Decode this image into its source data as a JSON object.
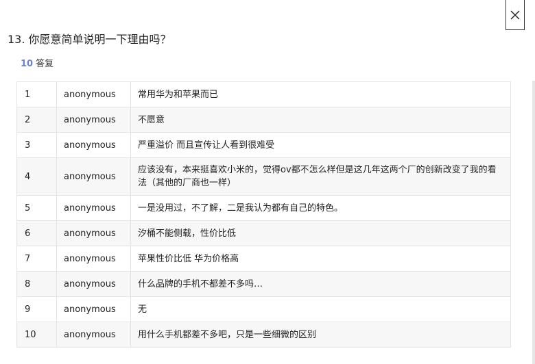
{
  "header": {
    "question_title": "13. 你愿意简单说明一下理由吗？",
    "answer_count": "10",
    "answer_label": "答复",
    "close_icon": "close-icon"
  },
  "table": {
    "rows": [
      {
        "index": "1",
        "respondent": "anonymous",
        "answer": "常用华为和苹果而已"
      },
      {
        "index": "2",
        "respondent": "anonymous",
        "answer": "不愿意"
      },
      {
        "index": "3",
        "respondent": "anonymous",
        "answer": "严重溢价 而且宣传让人看到很难受"
      },
      {
        "index": "4",
        "respondent": "anonymous",
        "answer": "应该没有，本来挺喜欢小米的，觉得ov都不怎么样但是这几年这两个厂的创新改变了我的看法（其他的厂商也一样）"
      },
      {
        "index": "5",
        "respondent": "anonymous",
        "answer": "一是没用过，不了解，二是我认为都有自己的特色。"
      },
      {
        "index": "6",
        "respondent": "anonymous",
        "answer": "汐桶不能侧载，性价比低"
      },
      {
        "index": "7",
        "respondent": "anonymous",
        "answer": "苹果性价比低 华为价格高"
      },
      {
        "index": "8",
        "respondent": "anonymous",
        "answer": "什么品牌的手机不都差不多吗…"
      },
      {
        "index": "9",
        "respondent": "anonymous",
        "answer": "无"
      },
      {
        "index": "10",
        "respondent": "anonymous",
        "answer": "用什么手机都差不多吧，只是一些细微的区别"
      }
    ]
  },
  "colors": {
    "accent": "#6a86c8",
    "row_alt_bg": "#f7f7f7",
    "border": "#e3e3e3"
  }
}
